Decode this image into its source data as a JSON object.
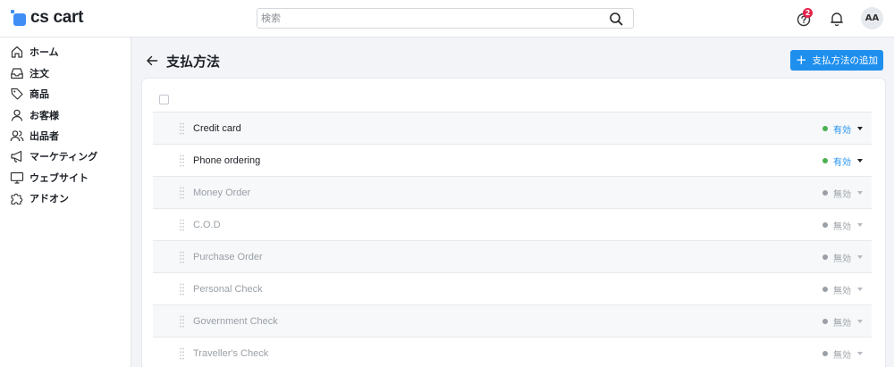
{
  "app": {
    "logo_text": "cs cart"
  },
  "search": {
    "placeholder": "検索",
    "value": ""
  },
  "header": {
    "help_badge_count": "2",
    "avatar_initials": "AA"
  },
  "colors": {
    "accent": "#1f8fee",
    "active": "#4cb050",
    "inactive": "#9aa0a6",
    "badge": "#e5234a"
  },
  "sidebar": {
    "items": [
      {
        "label": "ホーム",
        "icon": "home-icon"
      },
      {
        "label": "注文",
        "icon": "inbox-icon"
      },
      {
        "label": "商品",
        "icon": "tag-icon"
      },
      {
        "label": "お客様",
        "icon": "user-icon"
      },
      {
        "label": "出品者",
        "icon": "users-icon"
      },
      {
        "label": "マーケティング",
        "icon": "megaphone-icon"
      },
      {
        "label": "ウェブサイト",
        "icon": "monitor-icon"
      },
      {
        "label": "アドオン",
        "icon": "puzzle-icon"
      }
    ]
  },
  "page": {
    "title": "支払方法",
    "add_button_label": "支払方法の追加"
  },
  "payment_methods": [
    {
      "name": "Credit card",
      "status": "有効",
      "active": true
    },
    {
      "name": "Phone ordering",
      "status": "有効",
      "active": true
    },
    {
      "name": "Money Order",
      "status": "無効",
      "active": false
    },
    {
      "name": "C.O.D",
      "status": "無効",
      "active": false
    },
    {
      "name": "Purchase Order",
      "status": "無効",
      "active": false
    },
    {
      "name": "Personal Check",
      "status": "無効",
      "active": false
    },
    {
      "name": "Government Check",
      "status": "無効",
      "active": false
    },
    {
      "name": "Traveller's Check",
      "status": "無効",
      "active": false
    }
  ]
}
